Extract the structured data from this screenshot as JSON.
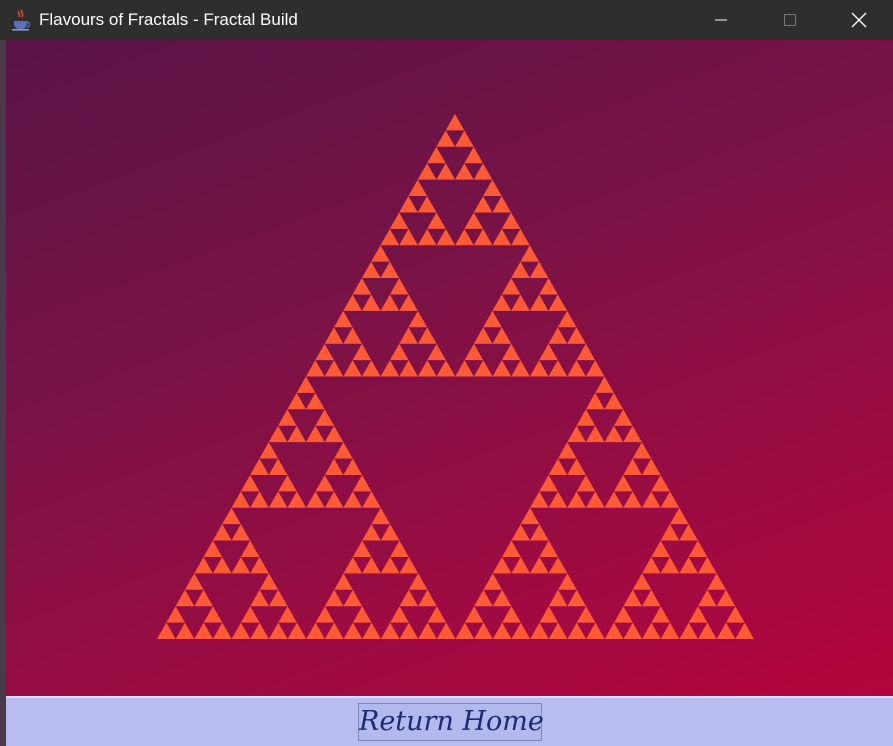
{
  "window": {
    "title": "Flavours of Fractals - Fractal Build",
    "app_icon": "java-cup-icon",
    "controls": {
      "minimize_icon": "minimize-icon",
      "maximize_icon": "maximize-icon",
      "close_icon": "close-icon"
    }
  },
  "fractal": {
    "type": "sierpinski-triangle",
    "depth": 5,
    "fill_color": "#ff5a36",
    "background_gradient": [
      "#5a1448",
      "#b3053b"
    ]
  },
  "footer": {
    "return_label": "Return Home",
    "bar_color": "#b8bcf0",
    "text_color": "#1f2a6e"
  }
}
